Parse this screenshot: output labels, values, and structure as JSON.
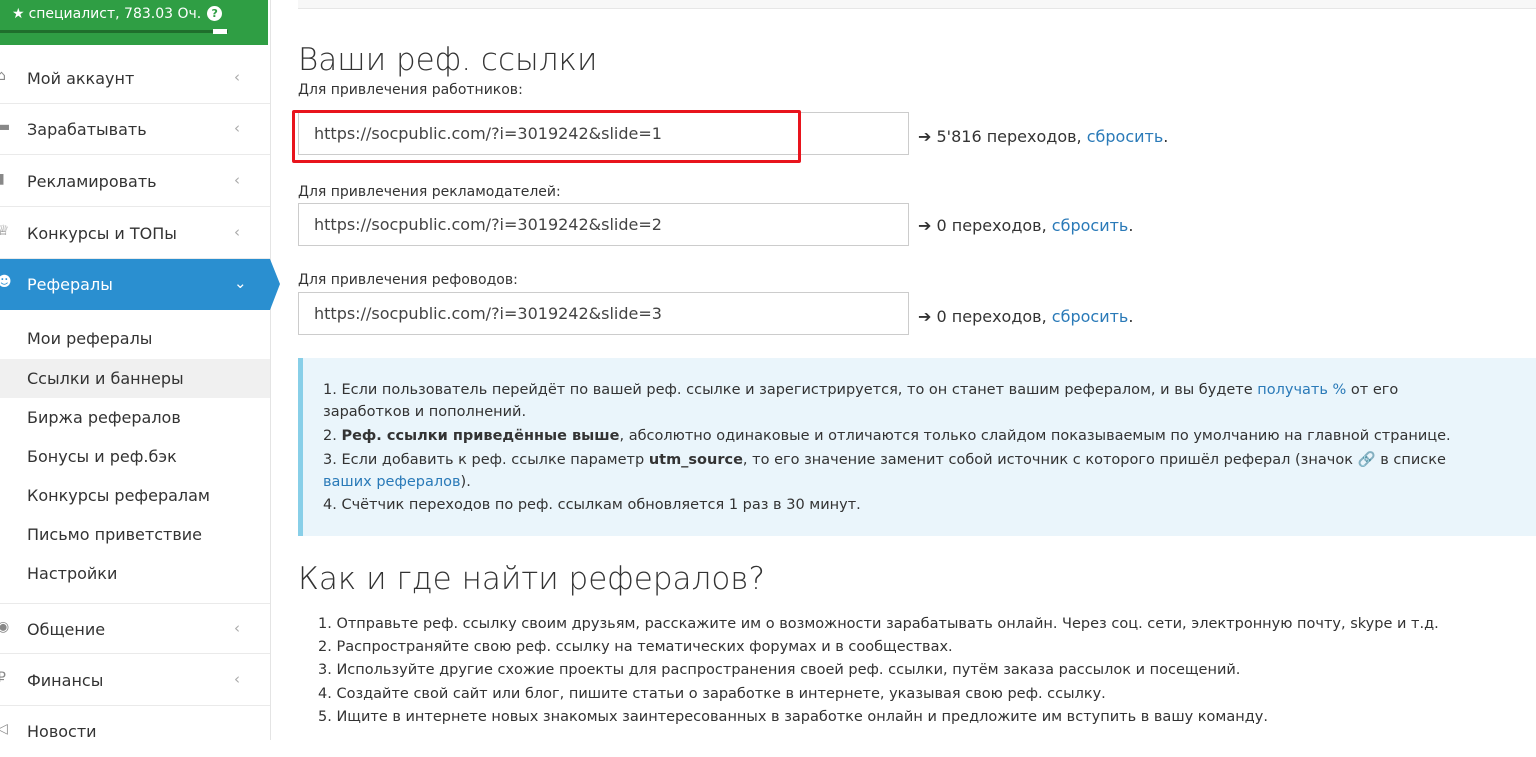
{
  "user": {
    "status_text": "специалист, 783.03 Оч.",
    "help_glyph": "?",
    "progress": 0.94
  },
  "menu": [
    {
      "label": "Мой аккаунт",
      "icon": "home-icon",
      "glyph": "⌂",
      "chev": "‹"
    },
    {
      "label": "Зарабатывать",
      "icon": "briefcase-icon",
      "glyph": "▬",
      "chev": "‹"
    },
    {
      "label": "Рекламировать",
      "icon": "bar-chart-icon",
      "glyph": "▮",
      "chev": "‹"
    },
    {
      "label": "Конкурсы и ТОПы",
      "icon": "trophy-icon",
      "glyph": "♕",
      "chev": "‹"
    },
    {
      "label": "Рефералы",
      "icon": "users-icon",
      "glyph": "☻",
      "chev": "⌄"
    }
  ],
  "submenu": [
    {
      "label": "Мои рефералы"
    },
    {
      "label": "Ссылки и баннеры"
    },
    {
      "label": "Биржа рефералов"
    },
    {
      "label": "Бонусы и реф.бэк"
    },
    {
      "label": "Конкурсы рефералам"
    },
    {
      "label": "Письмо приветствие"
    },
    {
      "label": "Настройки"
    }
  ],
  "menu_bottom": [
    {
      "label": "Общение",
      "icon": "chat-icon",
      "glyph": "◉",
      "chev": "‹"
    },
    {
      "label": "Финансы",
      "icon": "money-icon",
      "glyph": "₽",
      "chev": "‹"
    },
    {
      "label": "Новости",
      "icon": "bullhorn-icon",
      "glyph": "◁",
      "chev": ""
    }
  ],
  "main": {
    "title": "Ваши реф. ссылки",
    "links": [
      {
        "label": "Для привлечения работников:",
        "url": "https://socpublic.com/?i=3019242&slide=1",
        "arrow": "➔",
        "count": "5'816 переходов,",
        "reset": "сбросить",
        "dot": "."
      },
      {
        "label": "Для привлечения рекламодателей:",
        "url": "https://socpublic.com/?i=3019242&slide=2",
        "arrow": "➔",
        "count": "0 переходов,",
        "reset": "сбросить",
        "dot": "."
      },
      {
        "label": "Для привлечения рефоводов:",
        "url": "https://socpublic.com/?i=3019242&slide=3",
        "arrow": "➔",
        "count": "0 переходов,",
        "reset": "сбросить",
        "dot": "."
      }
    ],
    "info": {
      "l1a": "1. Если пользователь перейдёт по вашей реф. ссылке и зарегистрируется, то он станет вашим рефералом, и вы будете ",
      "l1link": "получать %",
      "l1b": " от его",
      "l1c": "заработков и пополнений.",
      "l2a": "2. ",
      "l2bold": "Реф. ссылки приведённые выше",
      "l2b": ", абсолютно одинаковые и отличаются только слайдом показываемым по умолчанию на главной странице.",
      "l3a": "3. Если добавить к реф. ссылке параметр ",
      "l3bold": "utm_source",
      "l3b": ", то его значение заменит собой источник с которого пришёл реферал (значок ",
      "l3glyph": "🔗",
      "l3c": " в списке",
      "l3link": "ваших рефералов",
      "l3d": ").",
      "l4": "4. Счётчик переходов по реф. ссылкам обновляется 1 раз в 30 минут."
    },
    "how_title": "Как и где найти рефералов?",
    "how_items": [
      "1. Отправьте реф. ссылку своим друзьям, расскажите им о возможности зарабатывать онлайн. Через соц. сети, электронную почту, skype и т.д.",
      "2. Распространяйте свою реф. ссылку на тематических форумах и в сообществах.",
      "3. Используйте другие схожие проекты для распространения своей реф. ссылки, путём заказа рассылок и посещений.",
      "4. Создайте свой сайт или блог, пишите статьи о заработке в интернете, указывая свою реф. ссылку.",
      "5. Ищите в интернете новых знакомых заинтересованных в заработке онлайн и предложите им вступить в вашу команду."
    ]
  }
}
